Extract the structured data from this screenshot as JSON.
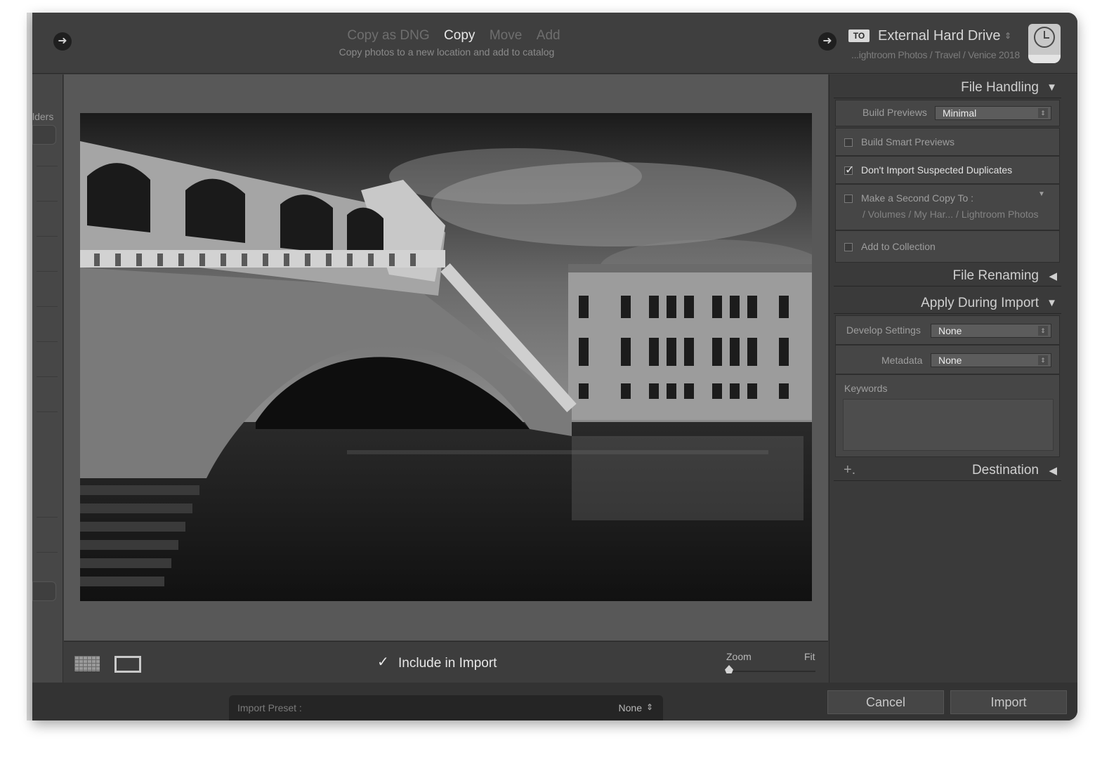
{
  "modes": {
    "items": [
      "Copy as DNG",
      "Copy",
      "Move",
      "Add"
    ],
    "active_index": 1,
    "description": "Copy photos to a new location and add to catalog"
  },
  "destination": {
    "badge": "TO",
    "title": "External Hard Drive",
    "path": "...ightroom Photos / Travel / Venice 2018",
    "icon": "time-machine-drive-icon"
  },
  "left_panel": {
    "label": "lders"
  },
  "toolbar": {
    "include_check": "✓",
    "include_label": "Include in Import",
    "zoom_label": "Zoom",
    "zoom_value": "Fit"
  },
  "file_handling": {
    "title": "File Handling",
    "build_previews_label": "Build Previews",
    "build_previews_value": "Minimal",
    "build_smart_previews_label": "Build Smart Previews",
    "build_smart_previews_checked": false,
    "dont_import_duplicates_label": "Don't Import Suspected Duplicates",
    "dont_import_duplicates_checked": true,
    "second_copy_label": "Make a Second Copy To :",
    "second_copy_checked": false,
    "second_copy_path": "/ Volumes / My Har... / Lightroom Photos",
    "add_to_collection_label": "Add to Collection",
    "add_to_collection_checked": false
  },
  "file_renaming": {
    "title": "File Renaming"
  },
  "apply_during_import": {
    "title": "Apply During Import",
    "develop_settings_label": "Develop Settings",
    "develop_settings_value": "None",
    "metadata_label": "Metadata",
    "metadata_value": "None",
    "keywords_label": "Keywords",
    "keywords_value": ""
  },
  "destination_section": {
    "title": "Destination",
    "plus": "+."
  },
  "bottom": {
    "preset_label": "Import Preset :",
    "preset_value": "None",
    "cancel_label": "Cancel",
    "import_label": "Import"
  }
}
